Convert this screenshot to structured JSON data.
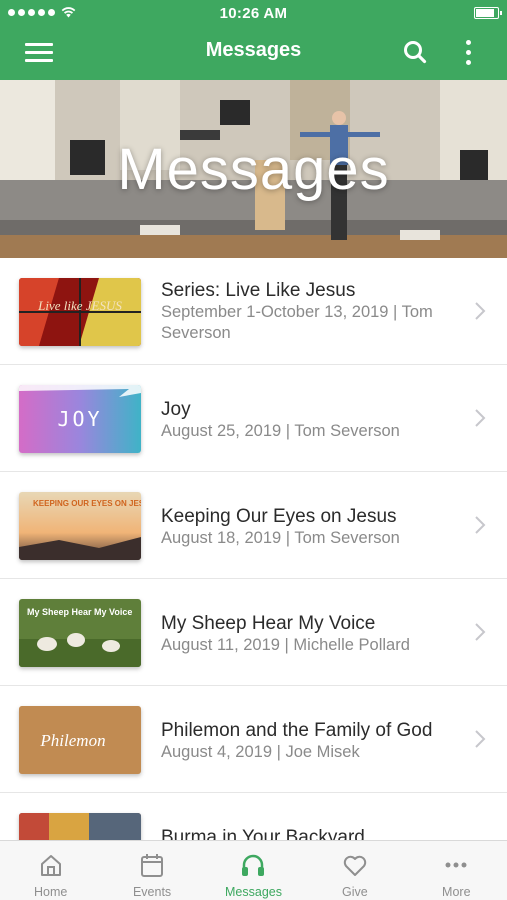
{
  "status_bar": {
    "time": "10:26 AM"
  },
  "nav": {
    "title": "Messages"
  },
  "hero": {
    "title": "Messages"
  },
  "messages": [
    {
      "title": "Series: Live Like Jesus",
      "subtitle": "September 1-October 13, 2019  |  Tom Severson",
      "thumb_text": "Live like JESUS"
    },
    {
      "title": "Joy",
      "subtitle": "August 25, 2019  |  Tom Severson",
      "thumb_text": "JOY"
    },
    {
      "title": "Keeping Our Eyes on Jesus",
      "subtitle": "August 18, 2019  |  Tom Severson",
      "thumb_text": "KEEPING OUR EYES ON JESUS"
    },
    {
      "title": "My Sheep Hear My Voice",
      "subtitle": "August 11, 2019  |  Michelle Pollard",
      "thumb_text": "My Sheep Hear My Voice"
    },
    {
      "title": "Philemon and the Family of God",
      "subtitle": "August 4, 2019  |  Joe Misek",
      "thumb_text": "Philemon"
    },
    {
      "title": "Burma in Your Backyard",
      "subtitle": "",
      "thumb_text": ""
    }
  ],
  "tabs": [
    {
      "label": "Home",
      "icon": "home-icon",
      "active": false
    },
    {
      "label": "Events",
      "icon": "calendar-icon",
      "active": false
    },
    {
      "label": "Messages",
      "icon": "headphones-icon",
      "active": true
    },
    {
      "label": "Give",
      "icon": "heart-icon",
      "active": false
    },
    {
      "label": "More",
      "icon": "more-dots-icon",
      "active": false
    }
  ],
  "colors": {
    "brand": "#3ea860",
    "tab_inactive": "#8f8f8f",
    "title_text": "#2b2b2b",
    "subtitle_text": "#8a8a8a"
  }
}
